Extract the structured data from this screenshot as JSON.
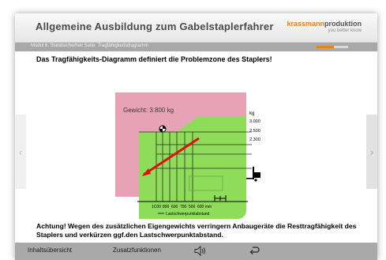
{
  "header": {
    "course_title": "Allgemeine Ausbildung zum Gabelstaplerfahrer",
    "brand_name_accent": "krassmann",
    "brand_name_rest": "produktion",
    "brand_tagline": "you better know"
  },
  "subbar": {
    "breadcrumb": "Modul 6: Standsicherheit   Seite: Tragfähigkeitsdiagramm",
    "progress_fraction": 0.55
  },
  "content": {
    "heading": "Das Tragfähigkeits-Diagramm definiert die Problemzone des Staplers!",
    "warning": "Achtung! Wegen des zusätzlichen Eigengewichts verringern Anbaugeräte die Resttragfähigkeit des Staplers und verkürzen ggf.den Lastschwerpunktabstand."
  },
  "diagram": {
    "weight_label": "Gewicht: 3.800 kg",
    "unit_kg": "kg",
    "y_ticks": [
      "3.000",
      "2.500",
      "2.300"
    ],
    "x_ticks": [
      "1C00",
      "800",
      "600",
      "700",
      "500",
      "600 mm"
    ],
    "x_axis_label": "Lastschwerpunktabstand",
    "colors": {
      "problem_zone": "#e7a2b5",
      "safe_zone": "#8fdc5a",
      "arrow": "#e01010"
    }
  },
  "navigation": {
    "left_arrow": "‹",
    "right_arrow": "›"
  },
  "footer": {
    "overview": "Inhaltsübersicht",
    "extras": "Zusatzfunktionen",
    "audio_icon": "speaker-icon",
    "back_icon": "return-icon"
  }
}
